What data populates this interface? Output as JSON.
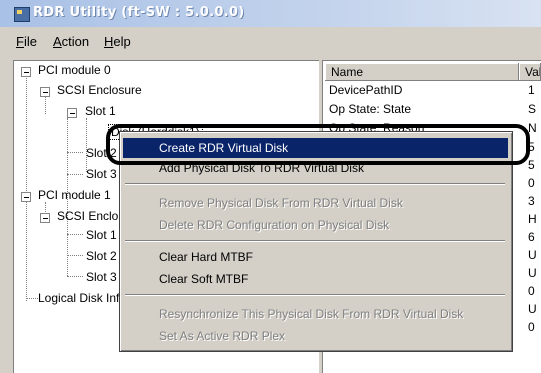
{
  "window": {
    "title": "RDR Utility (ft-SW : 5.0.0.0)"
  },
  "menu": {
    "file_ul": "F",
    "file_rest": "ile",
    "action_ul": "A",
    "action_rest": "ction",
    "help_ul": "H",
    "help_rest": "elp"
  },
  "tree": {
    "pci0": "PCI module 0",
    "scsi0": "SCSI Enclosure",
    "slot1": "Slot 1",
    "disk": "Disk (Harddisk1)",
    "slot2": "Slot 2",
    "slot3": "Slot 3",
    "pci1": "PCI module 1",
    "scsi1": "SCSI Enclosure",
    "slot1b": "Slot 1",
    "slot2b": "Slot 2",
    "slot3b": "Slot 3",
    "logical": "Logical Disk Information"
  },
  "list": {
    "headers": [
      "Name",
      "Value"
    ],
    "names": [
      "DevicePathID",
      "Op State: State",
      "Op State: Reason"
    ],
    "values": [
      "1",
      "S",
      "N",
      "5",
      "5",
      "0",
      "3",
      "H",
      "6",
      "U",
      "U",
      "0",
      "U",
      "0"
    ]
  },
  "context_menu": {
    "items": [
      "Create RDR Virtual Disk",
      "Add Physical Disk To RDR Virtual Disk",
      "Remove Physical Disk From RDR Virtual Disk",
      "Delete RDR Configuration on Physical Disk",
      "Clear Hard MTBF",
      "Clear Soft MTBF",
      "Resynchronize This Physical Disk From RDR Virtual Disk",
      "Set As Active RDR Plex"
    ]
  },
  "colors": {
    "highlight": "#0a246a",
    "chrome": "#d4d0c8",
    "titlebar": "#a9c1e6"
  }
}
